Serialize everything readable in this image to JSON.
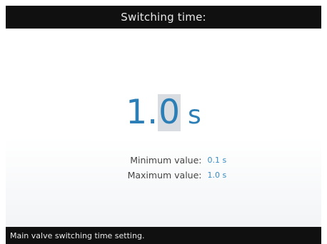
{
  "header": {
    "title": "Switching time:"
  },
  "value": {
    "integer_part": "1.",
    "decimal_part": "0",
    "unit": "s"
  },
  "limits": {
    "minimum_label": "Minimum value:",
    "minimum_value": "0.1 s",
    "maximum_label": "Maximum value:",
    "maximum_value": "1.0 s"
  },
  "status_bar": {
    "text": "Main valve switching time setting."
  },
  "colors": {
    "accent": "#2c7fb6",
    "bar_background": "#101010",
    "selected_digit_background": "#d9dde2"
  }
}
